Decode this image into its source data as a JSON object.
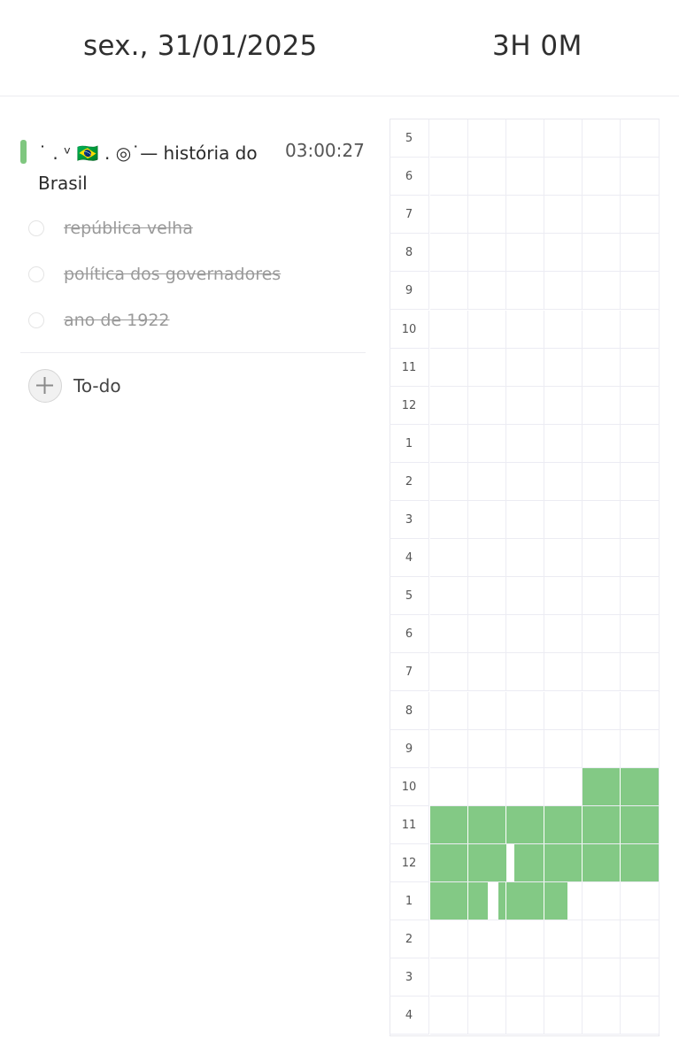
{
  "header": {
    "date": "sex., 31/01/2025",
    "total": "3H 0M"
  },
  "task": {
    "color": "#7fc77f",
    "title": "˙ . ᵛ 🇧🇷 . ◎˙— história do Brasil",
    "time": "03:00:27",
    "subtasks": [
      {
        "label": "república velha",
        "done": true
      },
      {
        "label": "política dos governadores",
        "done": true
      },
      {
        "label": "ano de 1922",
        "done": true
      }
    ]
  },
  "add": {
    "icon": "plus-icon",
    "label": "To-do"
  },
  "timeline": {
    "block_color": "#83c985",
    "hours": [
      "5",
      "6",
      "7",
      "8",
      "9",
      "10",
      "11",
      "12",
      "1",
      "2",
      "3",
      "4",
      "5",
      "6",
      "7",
      "8",
      "9",
      "10",
      "11",
      "12",
      "1",
      "2",
      "3",
      "4"
    ],
    "filled_segments": [
      {
        "row": 17,
        "from": 0.667,
        "to": 1.0
      },
      {
        "row": 18,
        "from": 0.0,
        "to": 1.0
      },
      {
        "row": 19,
        "from": 0.0,
        "to": 0.333
      },
      {
        "row": 19,
        "from": 0.367,
        "to": 1.0
      },
      {
        "row": 20,
        "from": 0.0,
        "to": 0.25
      },
      {
        "row": 20,
        "from": 0.3,
        "to": 0.6
      }
    ]
  }
}
